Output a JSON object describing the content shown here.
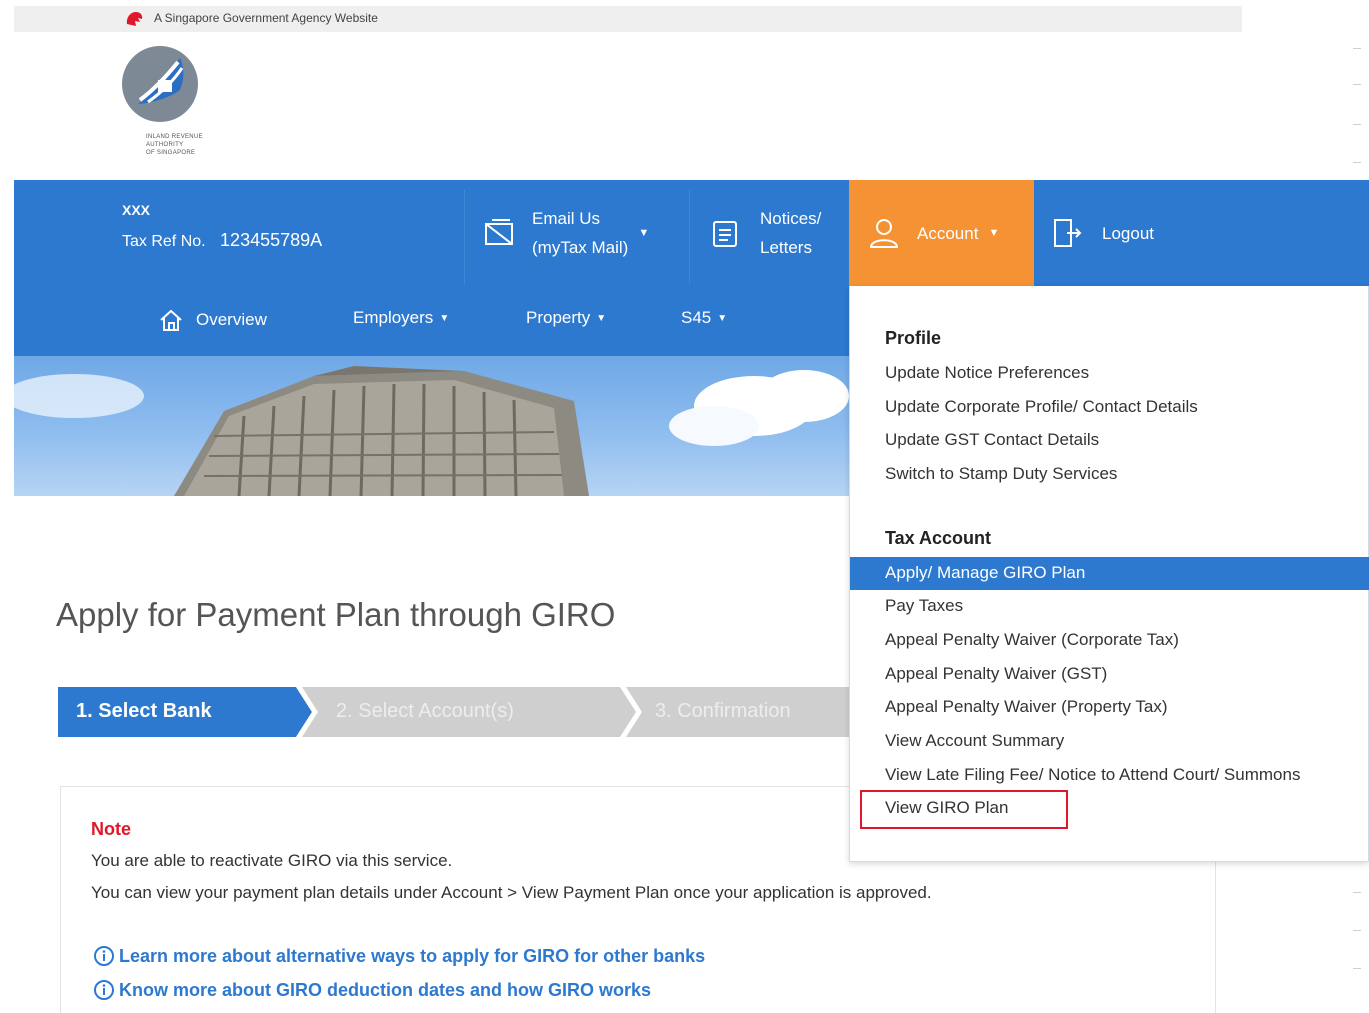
{
  "gov_banner": {
    "text": "A Singapore Government Agency Website"
  },
  "logo": {
    "lines": [
      "INLAND REVENUE",
      "AUTHORITY",
      "OF SINGAPORE"
    ]
  },
  "user": {
    "name": "XXX",
    "taxref_label": "Tax Ref No.",
    "taxref": "123455789A"
  },
  "topnav": {
    "email_line1": "Email Us",
    "email_line2": "(myTax Mail)",
    "notices_line1": "Notices/",
    "notices_line2": "Letters",
    "account": "Account",
    "logout": "Logout"
  },
  "subnav": {
    "overview": "Overview",
    "employers": "Employers",
    "property": "Property",
    "s45": "S45"
  },
  "page": {
    "title": "Apply for Payment Plan through GIRO",
    "steps": [
      "1. Select Bank",
      "2. Select Account(s)",
      "3. Confirmation"
    ]
  },
  "note": {
    "title": "Note",
    "line1": "You are able to reactivate GIRO via this service.",
    "line2": "You can view your payment plan details under Account > View Payment Plan once your application is approved.",
    "link1": "Learn more about alternative ways to apply for GIRO for other banks",
    "link2": "Know more about GIRO deduction dates and how GIRO works"
  },
  "account_menu": {
    "profile_heading": "Profile",
    "profile_items": [
      "Update Notice Preferences",
      "Update Corporate Profile/ Contact Details",
      "Update GST Contact Details",
      "Switch to Stamp Duty Services"
    ],
    "tax_heading": "Tax Account",
    "tax_items": [
      "Apply/ Manage GIRO Plan",
      "Pay Taxes",
      "Appeal Penalty Waiver (Corporate Tax)",
      "Appeal Penalty Waiver (GST)",
      "Appeal Penalty Waiver (Property Tax)",
      "View Account Summary",
      "View Late Filing Fee/ Notice to Attend Court/ Summons",
      "View GIRO Plan"
    ]
  },
  "colors": {
    "nav_blue": "#2d79cf",
    "account_orange": "#f59233",
    "note_red": "#e0162b",
    "highlight_box": "#e0162b"
  }
}
